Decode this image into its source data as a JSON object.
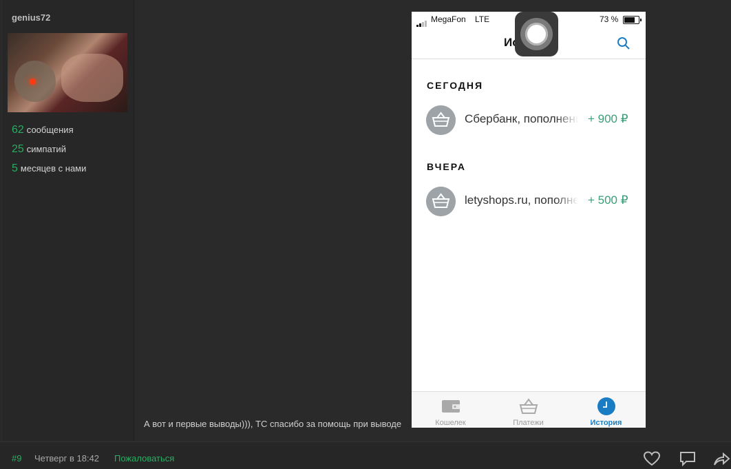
{
  "profile": {
    "username": "genius72",
    "stats": [
      {
        "number": "62",
        "label": "сообщения"
      },
      {
        "number": "25",
        "label": "симпатий"
      },
      {
        "number": "5",
        "label": "месяцев с нами"
      }
    ]
  },
  "post": {
    "text": "А вот и первые выводы))), ТС спасибо за помощь при выводе"
  },
  "footer": {
    "post_number": "#9",
    "date": "Четверг в 18:42",
    "report_label": "Пожаловаться",
    "icons": [
      "heart-icon",
      "comment-icon",
      "share-icon"
    ]
  },
  "phone": {
    "status": {
      "carrier": "MegaFon",
      "network": "LTE",
      "battery": "73 %",
      "battery_level": 0.73
    },
    "title_visible": "Ис",
    "sections": [
      {
        "header": "СЕГОДНЯ",
        "items": [
          {
            "title": "Сбербанк, пополнение",
            "amount": "+ 900 ₽"
          }
        ]
      },
      {
        "header": "ВЧЕРА",
        "items": [
          {
            "title": "letyshops.ru, пополнение",
            "amount": "+ 500 ₽"
          }
        ]
      }
    ],
    "tabs": [
      {
        "label": "Кошелек",
        "icon": "wallet-icon",
        "active": false
      },
      {
        "label": "Платежи",
        "icon": "basket-icon",
        "active": false
      },
      {
        "label": "История",
        "icon": "clock-icon",
        "active": true
      }
    ]
  },
  "colors": {
    "accent_green": "#27ae60",
    "amount_green": "#3a9e78",
    "active_tab_blue": "#1a7dc4"
  }
}
